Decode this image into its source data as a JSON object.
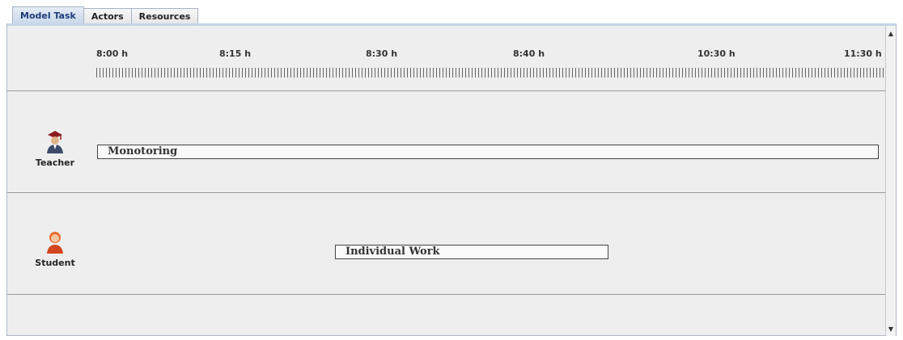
{
  "tabs": [
    {
      "label": "Model Task",
      "active": true
    },
    {
      "label": "Actors",
      "active": false
    },
    {
      "label": "Resources",
      "active": false
    }
  ],
  "timeline": {
    "labels": [
      "8:00 h",
      "8:15 h",
      "8:30 h",
      "8:40 h",
      "10:30 h",
      "11:30 h"
    ]
  },
  "lanes": [
    {
      "actor": "Teacher",
      "icon": "teacher-icon",
      "task": "Monotoring"
    },
    {
      "actor": "Student",
      "icon": "student-icon",
      "task": "Individual Work"
    }
  ],
  "colors": {
    "active_tab": "#c9d8ea",
    "panel_bg": "#eeeeee",
    "student_icon": "#d2451e",
    "teacher_hat": "#8b1e1e"
  }
}
